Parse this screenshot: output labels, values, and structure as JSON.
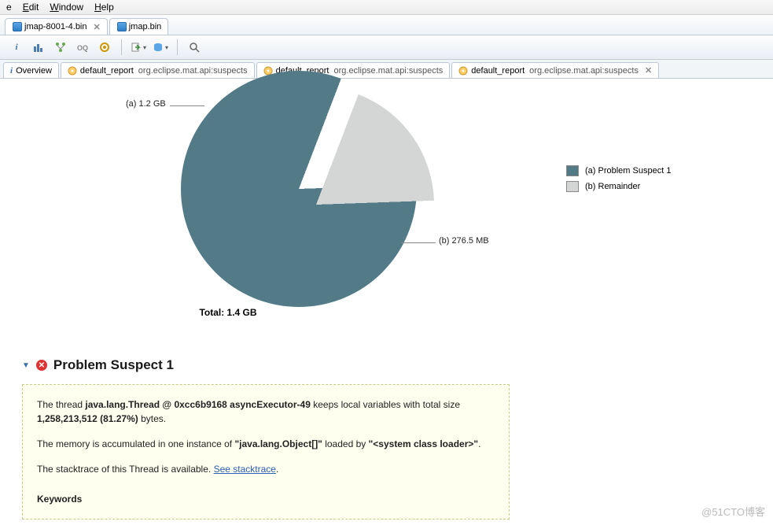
{
  "menu": {
    "file": "e",
    "edit": "Edit",
    "window": "Window",
    "help": "Help"
  },
  "file_tabs": [
    {
      "label": "jmap-8001-4.bin",
      "active": true
    },
    {
      "label": "jmap.bin",
      "active": false
    }
  ],
  "sub_tabs": [
    {
      "icon": "info",
      "label": "Overview"
    },
    {
      "icon": "gear",
      "label": "default_report",
      "rep": "org.eclipse.mat.api:suspects"
    },
    {
      "icon": "gear",
      "label": "default_report",
      "rep": "org.eclipse.mat.api:suspects"
    },
    {
      "icon": "gear",
      "label": "default_report",
      "rep": "org.eclipse.mat.api:suspects",
      "active": true
    }
  ],
  "chart_data": {
    "type": "pie",
    "title": "Total: 1.4 GB",
    "series": [
      {
        "name": "Problem Suspect 1",
        "label": "(a) 1.2 GB",
        "value_gb": 1.2,
        "percent": 81.27,
        "color": "#527a87",
        "legend": "(a)  Problem Suspect 1"
      },
      {
        "name": "Remainder",
        "label": "(b) 276.5 MB",
        "value_mb": 276.5,
        "percent": 18.73,
        "color": "#d4d6d6",
        "legend": "(b)  Remainder"
      }
    ]
  },
  "section": {
    "title": "Problem Suspect 1"
  },
  "report": {
    "p1_a": "The thread ",
    "p1_b": "java.lang.Thread @ 0xcc6b9168 asyncExecutor-49",
    "p1_c": " keeps local variables with total size ",
    "p1_d": "1,258,213,512 (81.27%)",
    "p1_e": " bytes.",
    "p2_a": "The memory is accumulated in one instance of ",
    "p2_b": "\"java.lang.Object[]\"",
    "p2_c": " loaded by ",
    "p2_d": "\"<system class loader>\"",
    "p2_e": ".",
    "p3_a": "The stacktrace of this Thread is available. ",
    "p3_link": "See stacktrace",
    "p3_b": ".",
    "keywords": "Keywords"
  },
  "watermark": "@51CTO博客"
}
